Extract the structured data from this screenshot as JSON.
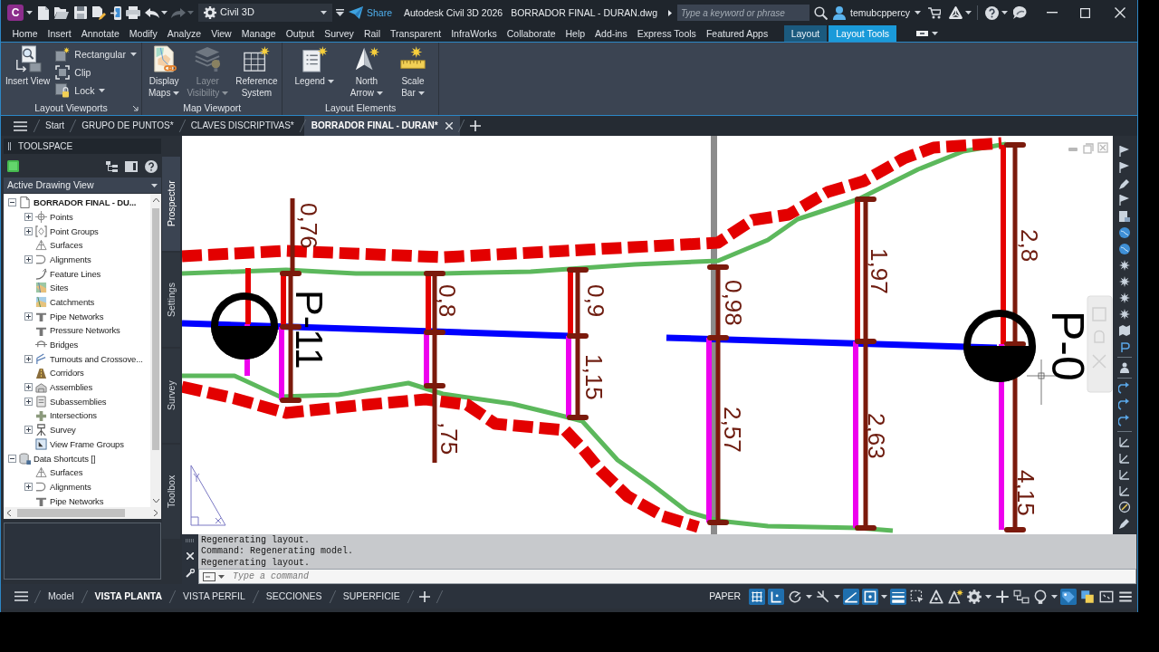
{
  "title_bar": {
    "logo_letter": "C",
    "redo_disabled": true,
    "workspace": "Civil 3D",
    "share": "Share",
    "app_name": "Autodesk Civil 3D 2026",
    "file_name": "BORRADOR FINAL - DURAN.dwg",
    "search": {
      "placeholder": "Type a keyword or phrase"
    },
    "user": "temubcppercy"
  },
  "ribbon_tabs": [
    {
      "label": "Home",
      "selected": false,
      "kind": "standard"
    },
    {
      "label": "Insert",
      "selected": false,
      "kind": "standard"
    },
    {
      "label": "Annotate",
      "selected": false,
      "kind": "standard"
    },
    {
      "label": "Modify",
      "selected": false,
      "kind": "standard"
    },
    {
      "label": "Analyze",
      "selected": false,
      "kind": "standard"
    },
    {
      "label": "View",
      "selected": false,
      "kind": "standard"
    },
    {
      "label": "Manage",
      "selected": false,
      "kind": "standard"
    },
    {
      "label": "Output",
      "selected": false,
      "kind": "standard"
    },
    {
      "label": "Survey",
      "selected": false,
      "kind": "standard"
    },
    {
      "label": "Rail",
      "selected": false,
      "kind": "standard"
    },
    {
      "label": "Transparent",
      "selected": false,
      "kind": "standard"
    },
    {
      "label": "InfraWorks",
      "selected": false,
      "kind": "standard"
    },
    {
      "label": "Collaborate",
      "selected": false,
      "kind": "standard"
    },
    {
      "label": "Help",
      "selected": false,
      "kind": "standard"
    },
    {
      "label": "Add-ins",
      "selected": false,
      "kind": "standard"
    },
    {
      "label": "Express Tools",
      "selected": false,
      "kind": "standard"
    },
    {
      "label": "Featured Apps",
      "selected": false,
      "kind": "standard"
    },
    {
      "label": "Layout",
      "selected": false,
      "kind": "contextual"
    },
    {
      "label": "Layout Tools",
      "selected": true,
      "kind": "contextual"
    }
  ],
  "ribbon_panels": [
    {
      "title": "Layout Viewports",
      "launcher": true,
      "buttons": [
        {
          "label": "Insert View",
          "kind": "wide",
          "dropdown": false,
          "disabled": false
        },
        {
          "label": "Rectangular",
          "kind": "small",
          "dropdown": true,
          "disabled": false
        },
        {
          "label": "Clip",
          "kind": "small",
          "dropdown": false,
          "disabled": false
        },
        {
          "label": "Lock",
          "kind": "small",
          "dropdown": true,
          "disabled": false
        }
      ]
    },
    {
      "title": "Map Viewport",
      "launcher": false,
      "buttons": [
        {
          "label": "Display Maps",
          "kind": "large",
          "dropdown": true,
          "disabled": false
        },
        {
          "label": "Layer Visibility",
          "kind": "large",
          "dropdown": true,
          "disabled": true
        },
        {
          "label": "Reference System",
          "kind": "large",
          "dropdown": false,
          "disabled": false
        }
      ]
    },
    {
      "title": "Layout Elements",
      "launcher": false,
      "buttons": [
        {
          "label": "Legend",
          "kind": "large",
          "dropdown": true,
          "disabled": false
        },
        {
          "label": "North Arrow",
          "kind": "large",
          "dropdown": true,
          "disabled": false
        },
        {
          "label": "Scale Bar",
          "kind": "large",
          "dropdown": true,
          "disabled": false
        }
      ]
    }
  ],
  "file_tabs": [
    {
      "label": "Start",
      "selected": false
    },
    {
      "label": "GRUPO DE PUNTOS*",
      "selected": false
    },
    {
      "label": "CLAVES DISCRIPTIVAS*",
      "selected": false
    },
    {
      "label": "BORRADOR FINAL - DURAN*",
      "selected": true
    }
  ],
  "toolspace": {
    "title": "TOOLSPACE",
    "view": "Active Drawing View",
    "tree": [
      {
        "label": "BORRADOR FINAL - DU...",
        "current": true,
        "expanded": true,
        "children": [
          {
            "label": "Points",
            "expanded": false
          },
          {
            "label": "Point Groups",
            "expanded": false
          },
          {
            "label": "Surfaces"
          },
          {
            "label": "Alignments",
            "expanded": false
          },
          {
            "label": "Feature Lines"
          },
          {
            "label": "Sites"
          },
          {
            "label": "Catchments"
          },
          {
            "label": "Pipe Networks",
            "expanded": false
          },
          {
            "label": "Pressure Networks"
          },
          {
            "label": "Bridges"
          },
          {
            "label": "Turnouts and Crossove...",
            "expanded": false
          },
          {
            "label": "Corridors"
          },
          {
            "label": "Assemblies",
            "expanded": false
          },
          {
            "label": "Subassemblies",
            "expanded": false
          },
          {
            "label": "Intersections"
          },
          {
            "label": "Survey",
            "expanded": false
          },
          {
            "label": "View Frame Groups"
          }
        ]
      },
      {
        "label": "Data Shortcuts []",
        "current": false,
        "expanded": true,
        "children": [
          {
            "label": "Surfaces"
          },
          {
            "label": "Alignments",
            "expanded": false
          },
          {
            "label": "Pipe Networks"
          }
        ]
      }
    ],
    "side_tabs": [
      {
        "label": "Prospector",
        "selected": true
      },
      {
        "label": "Settings",
        "selected": false
      },
      {
        "label": "Survey",
        "selected": false
      },
      {
        "label": "Toolbox",
        "selected": false
      }
    ]
  },
  "drawing": {
    "manholes": [
      {
        "label": "P-11"
      },
      {
        "label": "P-0"
      }
    ],
    "sections": [
      {
        "upper": "0,76"
      },
      {
        "upper": "0,8",
        "lower": ",75"
      },
      {
        "upper": "0,9",
        "lower": "1,15"
      },
      {
        "upper": "0,98",
        "lower": "2,57"
      },
      {
        "upper": "1,97",
        "lower": "2,63"
      },
      {
        "upper": "2,8",
        "lower": "4,15"
      }
    ]
  },
  "command_line": {
    "history": [
      "Regenerating layout.",
      "Command: Regenerating model.",
      "Regenerating layout."
    ],
    "placeholder": "Type a command"
  },
  "layout_tabs": [
    {
      "label": "Model",
      "selected": false
    },
    {
      "label": "VISTA PLANTA",
      "selected": true
    },
    {
      "label": "VISTA PERFIL",
      "selected": false
    },
    {
      "label": "SECCIONES",
      "selected": false
    },
    {
      "label": "SUPERFICIE",
      "selected": false
    }
  ],
  "status_bar": {
    "space": "PAPER",
    "tools": [
      {
        "kind": "grid",
        "on": true,
        "dropdown": false
      },
      {
        "kind": "snap",
        "on": true,
        "dropdown": false
      },
      {
        "kind": "polar",
        "on": false,
        "dropdown": true
      },
      {
        "kind": "isodraft",
        "on": false,
        "dropdown": true
      },
      {
        "kind": "tracking",
        "on": true,
        "dropdown": false
      },
      {
        "kind": "osnap",
        "on": true,
        "dropdown": true
      },
      {
        "kind": "lineweight",
        "on": true,
        "dropdown": false
      },
      {
        "kind": "selection",
        "on": false,
        "dropdown": false
      },
      {
        "kind": "annovisible",
        "on": false,
        "dropdown": false
      },
      {
        "kind": "autoscale",
        "on": false,
        "dropdown": false
      },
      {
        "kind": "workspace",
        "on": false,
        "dropdown": true
      },
      {
        "kind": "monitor",
        "on": false,
        "dropdown": false
      },
      {
        "kind": "units",
        "on": false,
        "dropdown": false
      },
      {
        "kind": "isolate",
        "on": false,
        "dropdown": true
      },
      {
        "kind": "hardware",
        "on": true,
        "dropdown": false
      },
      {
        "kind": "clean",
        "on": false,
        "dropdown": false
      },
      {
        "kind": "fullscreen",
        "on": false,
        "dropdown": false
      },
      {
        "kind": "customize",
        "on": false,
        "dropdown": false
      }
    ]
  }
}
